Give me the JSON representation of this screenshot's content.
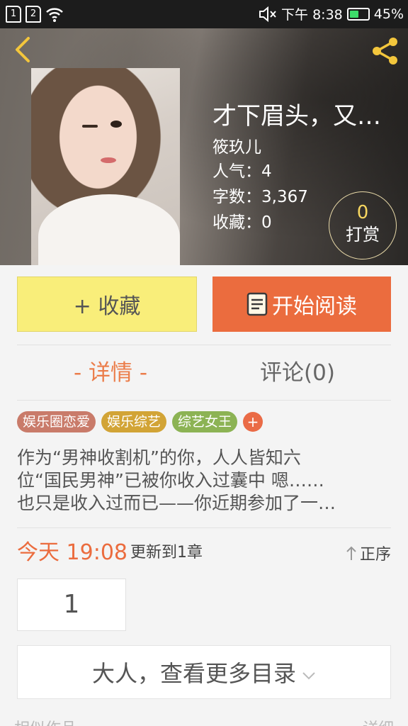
{
  "status_bar": {
    "sim1": "1",
    "sim2": "2",
    "time": "下午 8:38",
    "battery": "45%",
    "battery_level": 0.45,
    "icons": [
      "sim-card-icon",
      "wifi-icon",
      "mute-icon",
      "battery-icon"
    ]
  },
  "header": {
    "back_icon": "chevron-left-icon",
    "share_icon": "share-icon"
  },
  "book": {
    "title": "才下眉头，又…",
    "author": "筱玖儿",
    "popularity": "人气：4",
    "word_count": "字数：3,367",
    "favorites": "收藏：0"
  },
  "reward": {
    "count": "0",
    "label": "打赏"
  },
  "actions": {
    "collect": "+ 收藏",
    "read": "开始阅读"
  },
  "tabs": {
    "details": "- 详情 -",
    "comments": "评论(0)"
  },
  "tags": [
    {
      "label": "娱乐圈恋爱",
      "color": "#c97b6a"
    },
    {
      "label": "娱乐综艺",
      "color": "#d2a436"
    },
    {
      "label": "综艺女王",
      "color": "#8cb354"
    }
  ],
  "tag_add": "+",
  "intro": [
    "作为“男神收割机”的你，人人皆知六",
    "位“国民男神”已被你收入过囊中  嗯……",
    "也只是收入过而已——你近期参加了一…"
  ],
  "update": {
    "time": "今天 19:08",
    "text": "更新到1章",
    "sort": "正序"
  },
  "chapter_box": "1",
  "more_catalog": "大人，查看更多目录",
  "bottom": {
    "left": "相似作品",
    "right": "详细"
  },
  "colors": {
    "accent": "#eb6c3e",
    "collect_bg": "#f9ee7a",
    "reward_count": "#f6d660"
  }
}
